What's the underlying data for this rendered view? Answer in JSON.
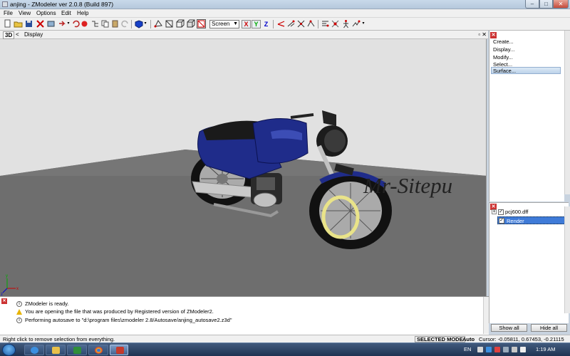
{
  "window": {
    "title": "anjing - ZModeler ver 2.0.8 (Build 897)",
    "min_glyph": "–",
    "max_glyph": "□",
    "close_glyph": "✕"
  },
  "menu": [
    "File",
    "View",
    "Options",
    "Edit",
    "Help"
  ],
  "toolbar": {
    "coord_mode": "Screen",
    "axis_x": "X",
    "axis_y": "Y",
    "axis_z": "Z"
  },
  "viewport": {
    "view_label": "3D",
    "back_glyph": "<",
    "mode_label": "Display",
    "controls": "▫ ✕",
    "watermark": "Mr-Sitepu",
    "axis_x": "x",
    "axis_y": "y",
    "axis_z": "z"
  },
  "commands": {
    "items": [
      "Create...",
      "Display...",
      "Modify...",
      "Select...",
      "Surface..."
    ],
    "active": "Surface..."
  },
  "scene_tree": {
    "expand_glyph": "+",
    "items": [
      {
        "label": "pcj600.dff",
        "checked": true
      },
      {
        "label": "Render",
        "checked": true,
        "selected": true
      }
    ],
    "check_glyph": "✓",
    "show_all": "Show all",
    "hide_all": "Hide all"
  },
  "log": {
    "lines": [
      {
        "type": "info",
        "text": "ZModeler is ready."
      },
      {
        "type": "warning",
        "text": "You are opening the file that was produced by Registered version of ZModeler2."
      },
      {
        "type": "info",
        "text": "Performing autosave to \"d:\\program files\\zmodeler 2.8/Autosave/anjing_autosave2.z3d\""
      }
    ]
  },
  "status": {
    "hint": "Right click to remove selection from everything.",
    "mode": "SELECTED MODE",
    "auto": "Auto",
    "cursor": "Cursor: -0.05811, 0.67453, -0.21115"
  },
  "taskbar": {
    "language": "EN",
    "time": "1:19 AM"
  },
  "colors": {
    "viewport_bg": "#e1e1e1",
    "ground": "#6e6e6e",
    "bike_body": "#1f2c8a",
    "selection": "#3f7bd8"
  }
}
